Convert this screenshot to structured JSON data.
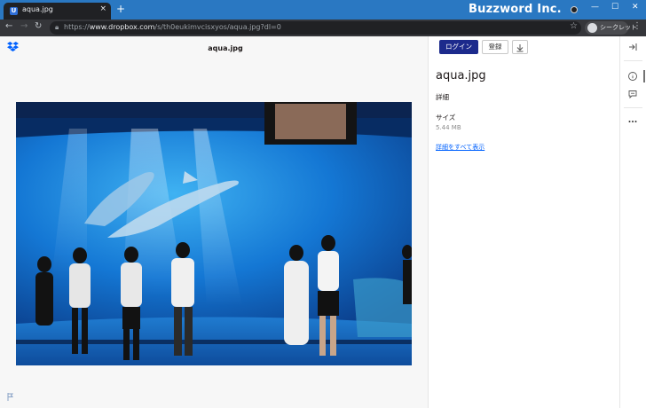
{
  "browser": {
    "tab_title": "aqua.jpg",
    "tab_close": "×",
    "new_tab": "+",
    "url_prefix": "https://",
    "url_host": "www.dropbox.com",
    "url_path": "/s/th0eukimvcisxyos/aqua.jpg?dl=0",
    "incognito_label": "シークレット",
    "minimize": "—",
    "maximize": "☐",
    "close": "✕"
  },
  "watermark": "Buzzword Inc.",
  "viewer": {
    "file_name": "aqua.jpg"
  },
  "sidebar": {
    "login_label": "ログイン",
    "signup_label": "登録",
    "title": "aqua.jpg",
    "details_label": "詳細",
    "size_label": "サイズ",
    "size_value": "5.44 MB",
    "show_all_link": "詳細をすべて表示"
  },
  "icons": {
    "brand": "dropbox-icon",
    "download": "download-icon",
    "collapse": "collapse-panel-icon",
    "info": "info-icon",
    "comment": "comment-icon",
    "more": "more-icon",
    "flag": "flag-icon"
  },
  "colors": {
    "titlebar": "#2a78c2",
    "toolbar": "#35363a",
    "login_button": "#1c2a8c",
    "link": "#0061fe",
    "dropbox_blue": "#0061fe"
  }
}
